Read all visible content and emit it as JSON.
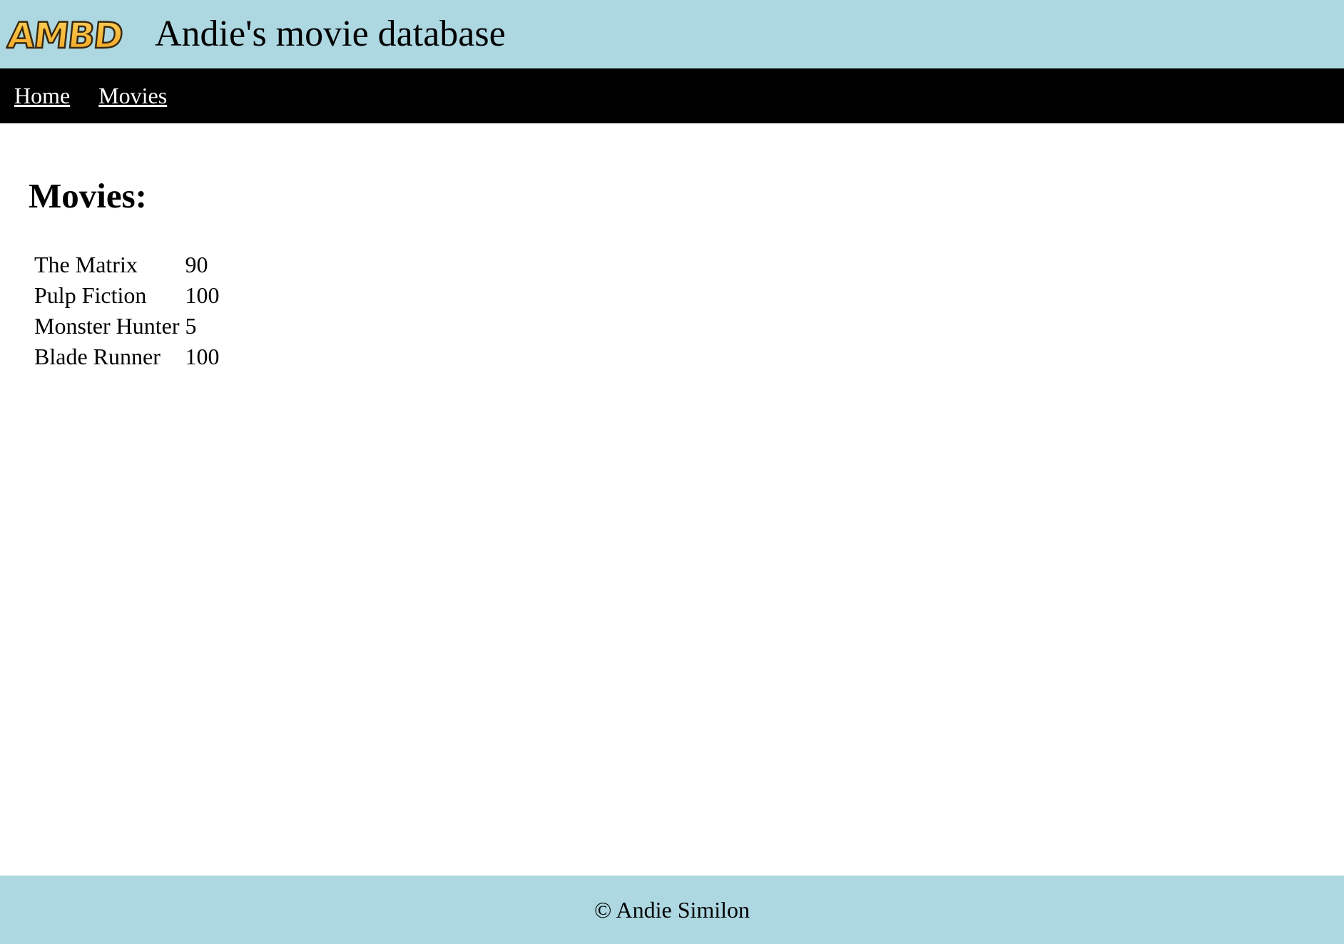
{
  "header": {
    "logo_text": "AMBD",
    "title": "Andie's movie database"
  },
  "nav": {
    "items": [
      {
        "label": "Home"
      },
      {
        "label": "Movies"
      }
    ]
  },
  "main": {
    "heading": "Movies:",
    "movies": [
      {
        "title": "The Matrix",
        "score": "90"
      },
      {
        "title": "Pulp Fiction",
        "score": "100"
      },
      {
        "title": "Monster Hunter",
        "score": "5"
      },
      {
        "title": "Blade Runner",
        "score": "100"
      }
    ]
  },
  "footer": {
    "copyright": "© Andie Similon"
  },
  "colors": {
    "header_bg": "#add8e2",
    "nav_bg": "#000000",
    "logo_fill": "#f7b733",
    "logo_outline": "#3a2a10"
  }
}
